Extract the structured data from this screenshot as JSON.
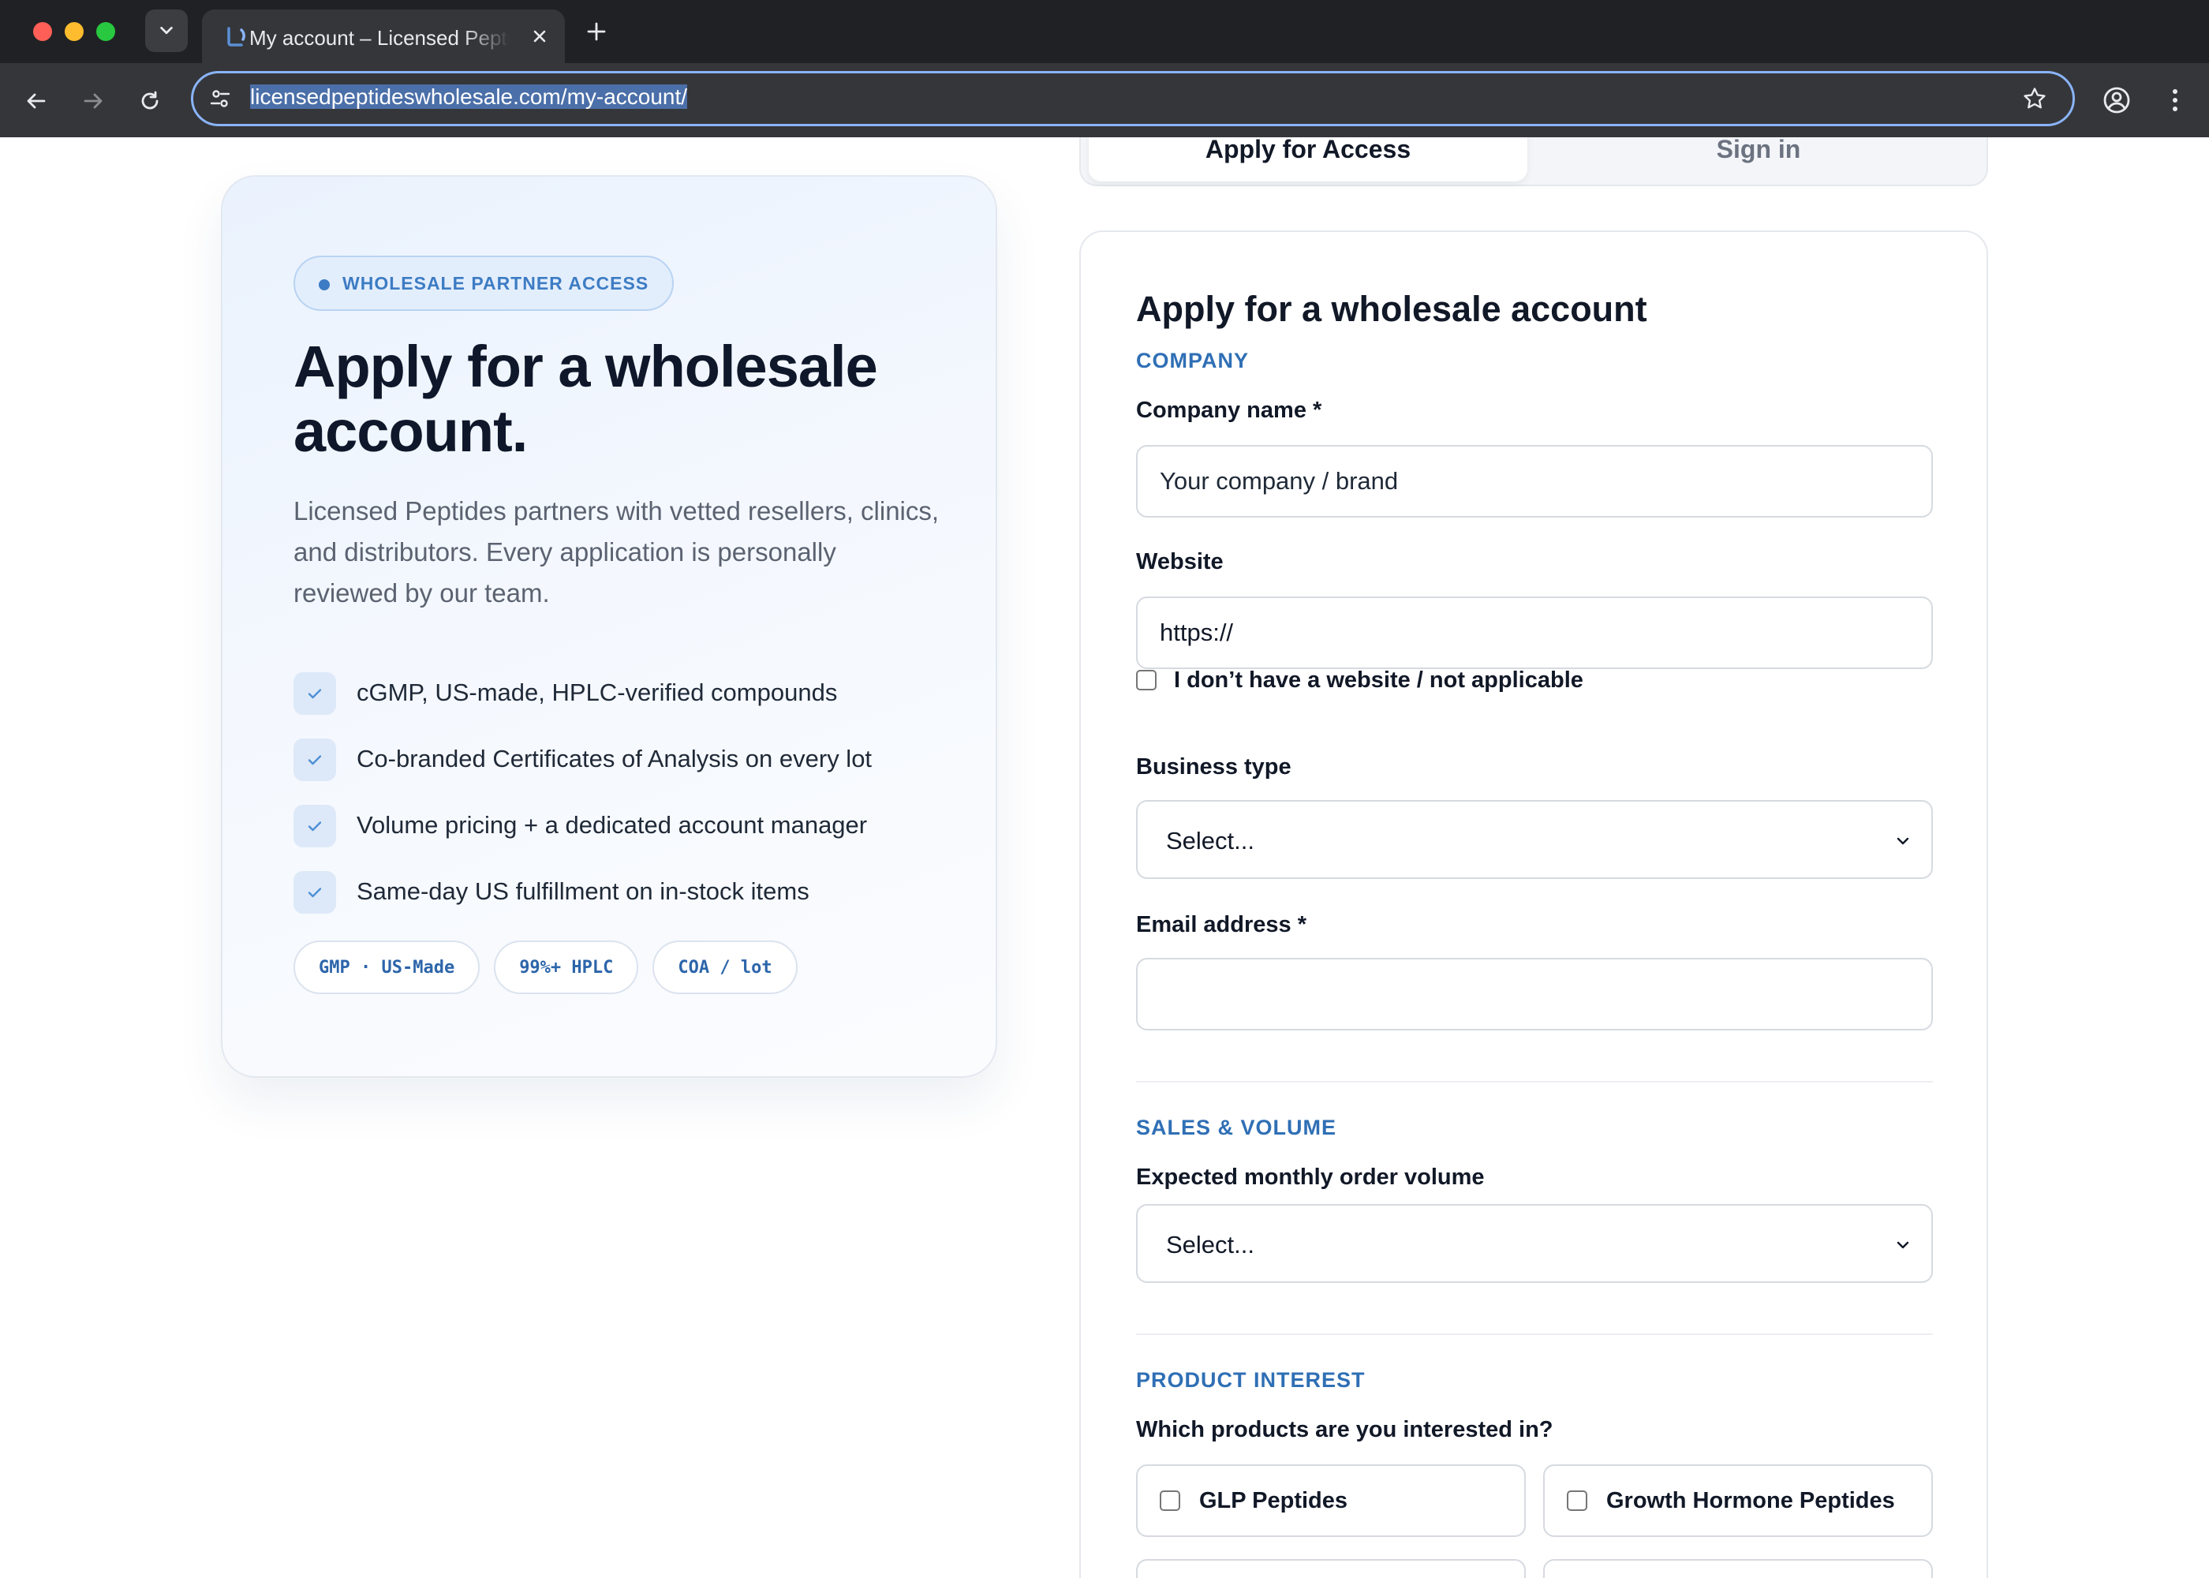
{
  "browser": {
    "tab_title": "My account – Licensed Peptides Wholesale",
    "url": "licensedpeptideswholesale.com/my-account/"
  },
  "hero": {
    "badge": "WHOLESALE PARTNER ACCESS",
    "title_line1": "Apply for a wholesale",
    "title_line2": "account.",
    "description": "Licensed Peptides partners with vetted resellers, clinics, and distributors. Every application is personally reviewed by our team.",
    "benefits": [
      "cGMP, US-made, HPLC-verified compounds",
      "Co-branded Certificates of Analysis on every lot",
      "Volume pricing + a dedicated account manager",
      "Same-day US fulfillment on in-stock items"
    ],
    "pills": [
      "GMP · US-Made",
      "99%+ HPLC",
      "COA / lot"
    ]
  },
  "auth_tabs": {
    "apply": "Apply for Access",
    "sign_in": "Sign in"
  },
  "form": {
    "title": "Apply for a wholesale account",
    "company_section": "COMPANY",
    "company_name_label": "Company name *",
    "company_name_placeholder": "Your company / brand",
    "website_label": "Website",
    "website_value": "https://",
    "no_website_label": "I don’t have a website / not applicable",
    "business_type_label": "Business type",
    "business_type_value": "Select...",
    "email_label": "Email address *",
    "email_value": "",
    "sales_section": "SALES & VOLUME",
    "volume_label": "Expected monthly order volume",
    "volume_value": "Select...",
    "product_section": "PRODUCT INTEREST",
    "products_question": "Which products are you interested in?",
    "products": [
      "GLP Peptides",
      "Growth Hormone Peptides"
    ]
  },
  "colors": {
    "accent": "#2f6fb5",
    "browser_frame": "#202124",
    "omnibox_focus": "#8ab4f8"
  }
}
